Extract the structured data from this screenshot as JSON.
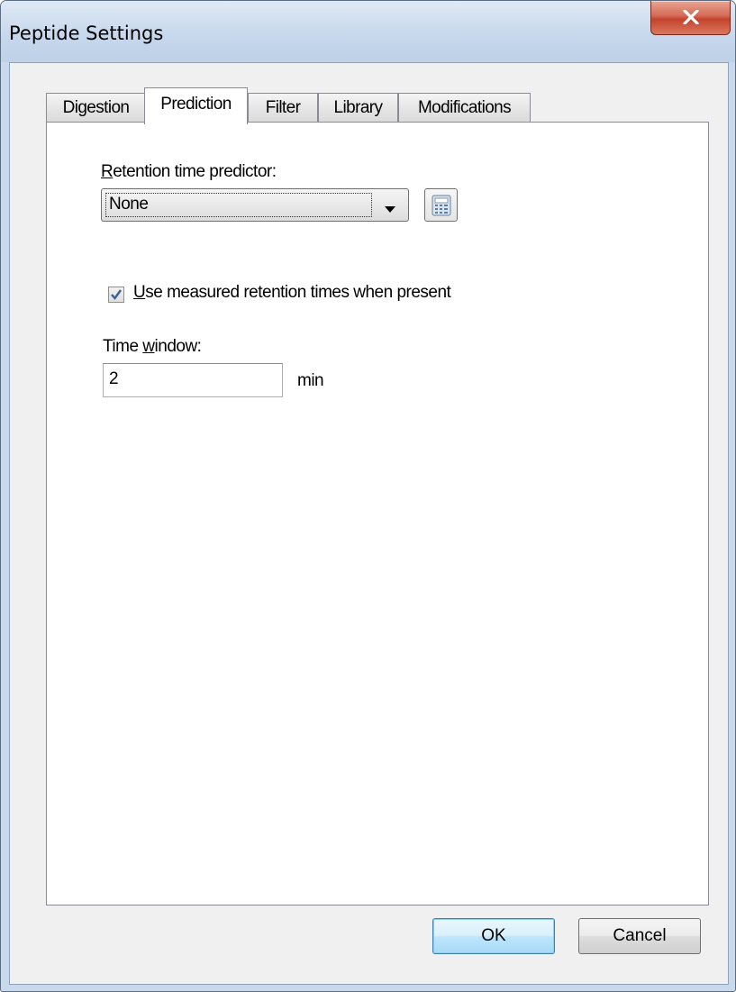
{
  "window": {
    "title": "Peptide Settings",
    "close_icon": "close-icon"
  },
  "tabs": [
    {
      "label": "Digestion",
      "active": false
    },
    {
      "label": "Prediction",
      "active": true
    },
    {
      "label": "Filter",
      "active": false
    },
    {
      "label": "Library",
      "active": false
    },
    {
      "label": "Modifications",
      "active": false
    }
  ],
  "prediction": {
    "rt_predictor_label_mnemonic": "R",
    "rt_predictor_label_rest": "etention time predictor:",
    "rt_predictor_value": "None",
    "calculator_icon": "calculator-icon",
    "use_measured_checked": true,
    "use_measured_mnemonic": "U",
    "use_measured_rest": "se measured retention times when present",
    "time_window_label_pre": "Time ",
    "time_window_label_mnemonic": "w",
    "time_window_label_post": "indow:",
    "time_window_value": "2",
    "time_window_unit": "min"
  },
  "buttons": {
    "ok": "OK",
    "cancel": "Cancel"
  },
  "colors": {
    "frame": "#c9d8ea",
    "close_button": "#c4432c",
    "default_button_border": "#3c7fb1"
  }
}
